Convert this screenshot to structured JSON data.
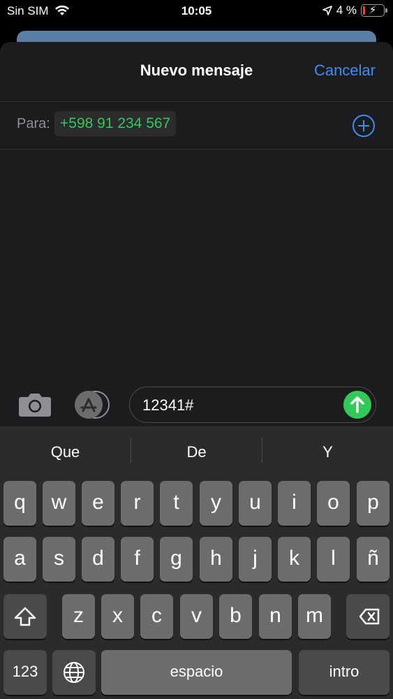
{
  "status_bar": {
    "carrier": "Sin SIM",
    "time": "10:05",
    "battery_percent": "4 %"
  },
  "header": {
    "title": "Nuevo mensaje",
    "cancel_label": "Cancelar"
  },
  "recipient": {
    "label": "Para:",
    "value": "+598 91 234 567"
  },
  "compose": {
    "text": "12341#"
  },
  "suggestions": [
    "Que",
    "De",
    "Y"
  ],
  "keyboard": {
    "row1": [
      "q",
      "w",
      "e",
      "r",
      "t",
      "y",
      "u",
      "i",
      "o",
      "p"
    ],
    "row2": [
      "a",
      "s",
      "d",
      "f",
      "g",
      "h",
      "j",
      "k",
      "l",
      "ñ"
    ],
    "row3": [
      "z",
      "x",
      "c",
      "v",
      "b",
      "n",
      "m"
    ],
    "numbers_label": "123",
    "space_label": "espacio",
    "return_label": "intro"
  },
  "colors": {
    "accent": "#3a8ff0",
    "recipient_green": "#34c759",
    "send_green": "#34c759",
    "battery_red": "#ff3b30"
  }
}
